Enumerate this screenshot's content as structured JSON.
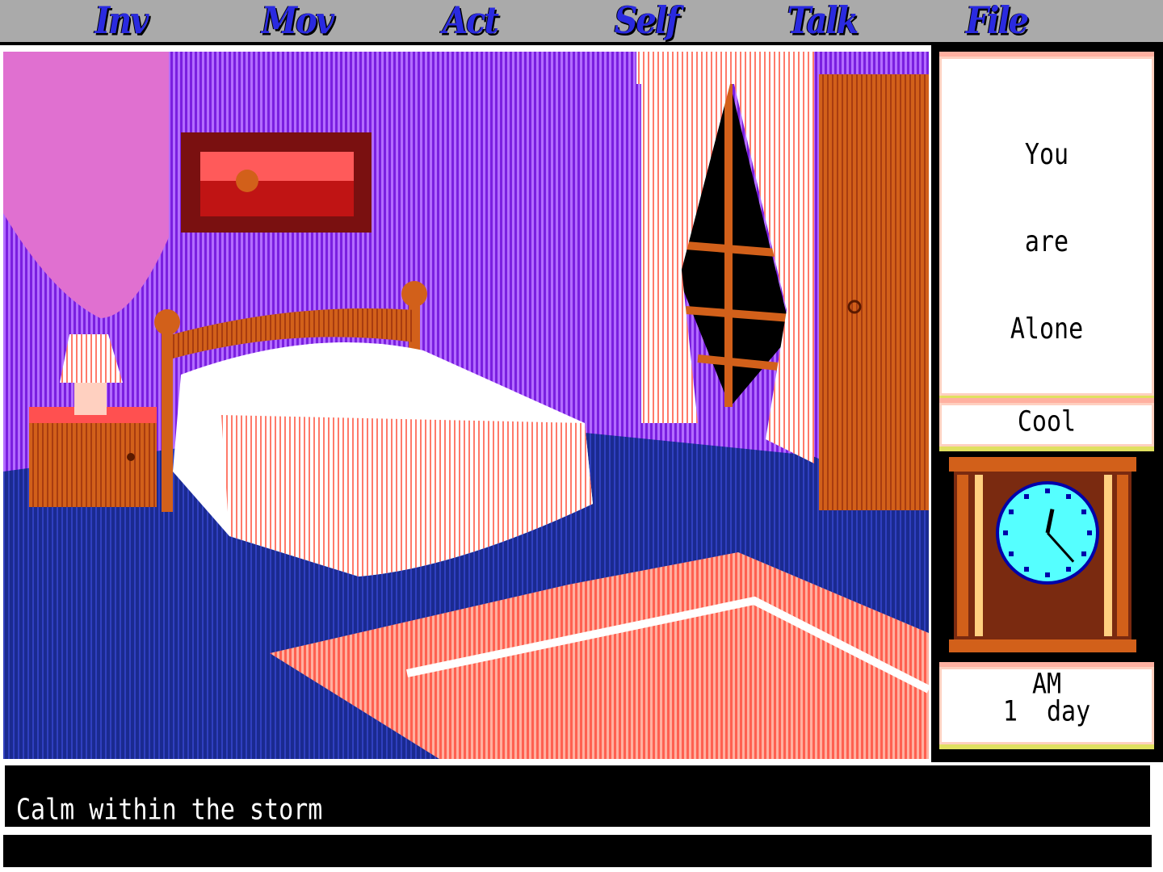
{
  "menu": {
    "items": [
      "Inv",
      "Mov",
      "Act",
      "Self",
      "Talk",
      "File"
    ]
  },
  "sidebar": {
    "companion_lines": [
      "You",
      "are",
      "Alone"
    ],
    "mood": "Cool",
    "clock": {
      "hour": 12,
      "minute": 23
    },
    "time_period": "AM",
    "day_count": "1  day"
  },
  "message": {
    "text": "Calm within the storm",
    "input": ""
  },
  "colors": {
    "menu_text": "#2a2ae0",
    "menu_bar": "#aaaaaa",
    "wall": "#8a2be2",
    "floor": "#1a2a90",
    "wood": "#d2601a",
    "clock_face": "#55ffff"
  }
}
